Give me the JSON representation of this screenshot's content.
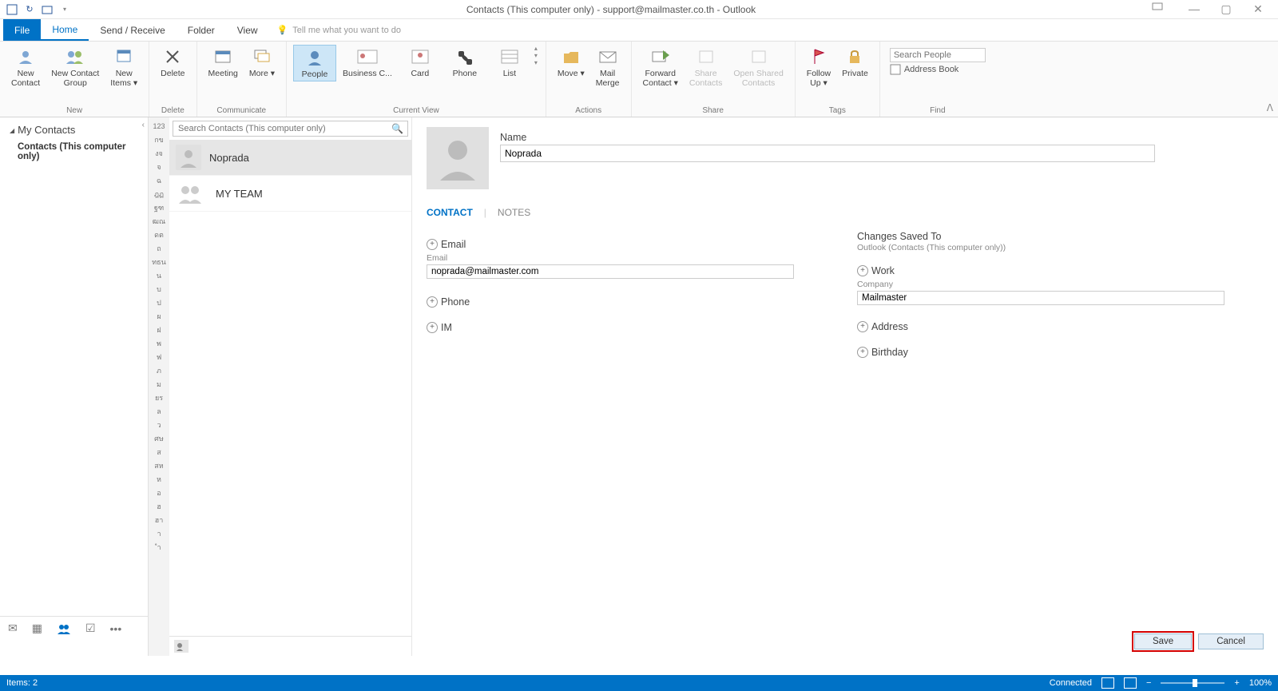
{
  "title": "Contacts (This computer only) - support@mailmaster.co.th - Outlook",
  "tabs": {
    "file": "File",
    "home": "Home",
    "sendreceive": "Send / Receive",
    "folder": "Folder",
    "view": "View"
  },
  "tellme": "Tell me what you want to do",
  "ribbon": {
    "new": {
      "label": "New",
      "newcontact": "New\nContact",
      "newcontactgroup": "New Contact\nGroup",
      "newitems": "New\nItems ▾"
    },
    "delete": {
      "label": "Delete",
      "btn": "Delete"
    },
    "communicate": {
      "label": "Communicate",
      "meeting": "Meeting",
      "more": "More ▾"
    },
    "currentview": {
      "label": "Current View",
      "people": "People",
      "business": "Business C...",
      "card": "Card",
      "phone": "Phone",
      "list": "List"
    },
    "actions": {
      "label": "Actions",
      "move": "Move ▾",
      "mailmerge": "Mail\nMerge"
    },
    "share": {
      "label": "Share",
      "forward": "Forward\nContact ▾",
      "sharecontacts": "Share\nContacts",
      "openshared": "Open Shared\nContacts"
    },
    "tags": {
      "label": "Tags",
      "followup": "Follow\nUp ▾",
      "private": "Private"
    },
    "find": {
      "label": "Find",
      "search_placeholder": "Search People",
      "addressbook": "Address Book"
    }
  },
  "nav": {
    "header": "My Contacts",
    "item": "Contacts (This computer only)"
  },
  "search_contacts_placeholder": "Search Contacts (This computer only)",
  "alpha": [
    "123",
    "กข",
    "งจ",
    "จ",
    "ฉ",
    "ฎฏ",
    "ฐฑ",
    "ฒณ",
    "ดต",
    "ถ",
    "ทธน",
    "น",
    "บ",
    "ป",
    "ผ",
    "ฝ",
    "พ",
    "ฟ",
    "ภ",
    "ม",
    "ยร",
    "ล",
    "ว",
    "ศษ",
    "ส",
    "สห",
    "ห",
    "อ",
    "ฮ",
    "ฮา",
    "า",
    "ำ"
  ],
  "contacts": [
    {
      "name": "Noprada",
      "type": "person",
      "selected": true
    },
    {
      "name": "MY TEAM",
      "type": "group",
      "selected": false
    }
  ],
  "reading": {
    "name_label": "Name",
    "name_value": "Noprada",
    "tabs": {
      "contact": "CONTACT",
      "notes": "NOTES"
    },
    "email_section": "Email",
    "email_label": "Email",
    "email_value": "noprada@mailmaster.com",
    "phone_section": "Phone",
    "im_section": "IM",
    "changes_saved": "Changes Saved To",
    "changes_saved_sub": "Outlook (Contacts (This computer only))",
    "work_section": "Work",
    "company_label": "Company",
    "company_value": "Mailmaster",
    "address_section": "Address",
    "birthday_section": "Birthday",
    "save": "Save",
    "cancel": "Cancel"
  },
  "status": {
    "items": "Items: 2",
    "connected": "Connected",
    "zoom": "100%"
  }
}
